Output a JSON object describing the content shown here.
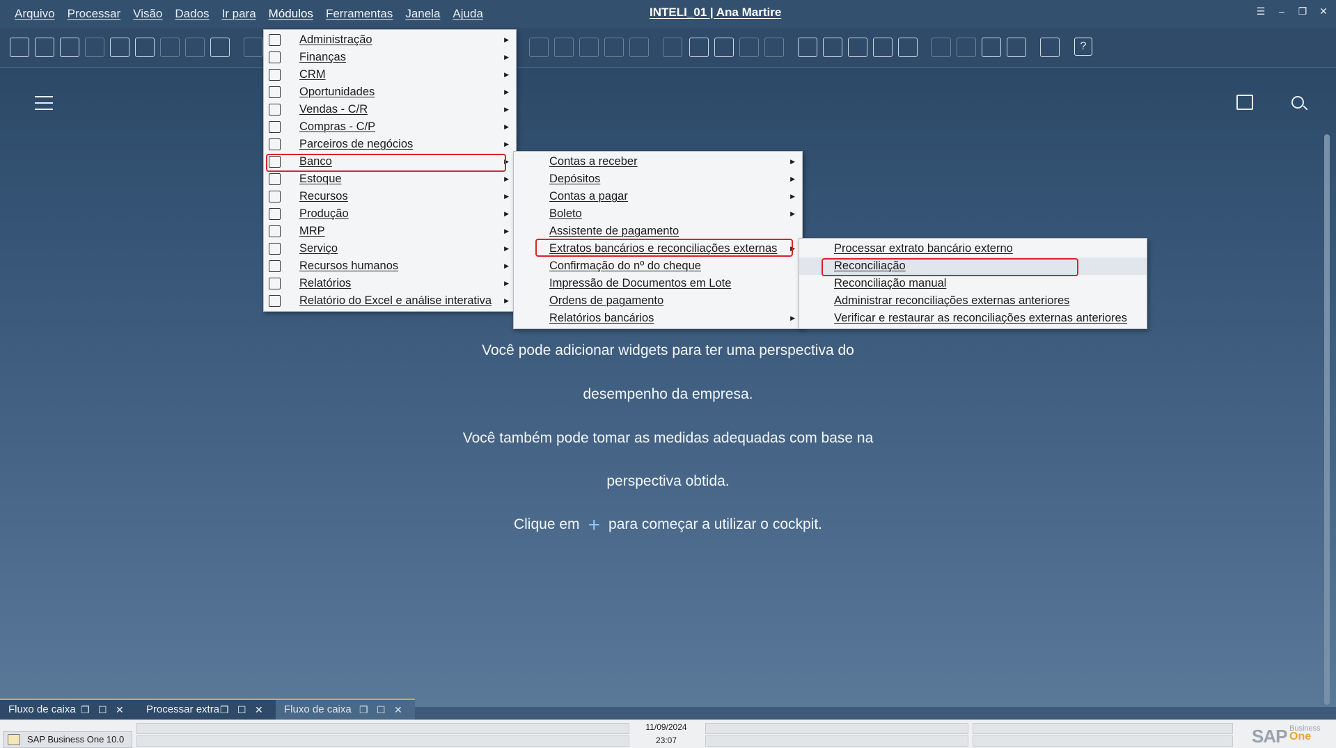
{
  "menubar": {
    "items": [
      "Arquivo",
      "Processar",
      "Visão",
      "Dados",
      "Ir para",
      "Módulos",
      "Ferramentas",
      "Janela",
      "Ajuda"
    ],
    "active": "Módulos",
    "window_title": "INTELI_01 | Ana Martire"
  },
  "main": {
    "info_line1": "Você pode adicionar widgets para ter uma perspectiva do",
    "info_line2": "desempenho da empresa.",
    "info_line3": "Você também pode tomar as medidas adequadas com base na",
    "info_line4": "perspectiva obtida.",
    "info_line5_pre": "Clique em",
    "info_line5_plus": "+",
    "info_line5_post": "para começar a utilizar o cockpit."
  },
  "modulos_menu": {
    "items": [
      {
        "label": "Administração",
        "icon": "admin-icon"
      },
      {
        "label": "Finanças",
        "icon": "finance-icon"
      },
      {
        "label": "CRM",
        "icon": "crm-icon"
      },
      {
        "label": "Oportunidades",
        "icon": "opportunities-icon"
      },
      {
        "label": "Vendas - C/R",
        "icon": "sales-icon"
      },
      {
        "label": "Compras - C/P",
        "icon": "cart-icon"
      },
      {
        "label": "Parceiros de negócios",
        "icon": "partners-icon"
      },
      {
        "label": "Banco",
        "icon": "bank-bag-icon"
      },
      {
        "label": "Estoque",
        "icon": "inventory-icon"
      },
      {
        "label": "Recursos",
        "icon": "resources-icon"
      },
      {
        "label": "Produção",
        "icon": "production-icon"
      },
      {
        "label": "MRP",
        "icon": "mrp-icon"
      },
      {
        "label": "Serviço",
        "icon": "service-icon"
      },
      {
        "label": "Recursos humanos",
        "icon": "hr-icon"
      },
      {
        "label": "Relatórios",
        "icon": "reports-icon"
      },
      {
        "label": "Relatório do Excel e análise interativa",
        "icon": "excel-report-icon"
      }
    ],
    "selected": "Banco"
  },
  "banco_menu": {
    "items": [
      {
        "label": "Contas a receber",
        "submenu": true
      },
      {
        "label": "Depósitos",
        "submenu": true
      },
      {
        "label": "Contas a pagar",
        "submenu": true
      },
      {
        "label": "Boleto",
        "submenu": true
      },
      {
        "label": "Assistente de pagamento",
        "submenu": false
      },
      {
        "label": "Extratos bancários e reconciliações externas",
        "submenu": true
      },
      {
        "label": "Confirmação do nº do cheque",
        "submenu": false
      },
      {
        "label": "Impressão de Documentos em Lote",
        "submenu": false
      },
      {
        "label": "Ordens de pagamento",
        "submenu": false
      },
      {
        "label": "Relatórios bancários",
        "submenu": true
      }
    ],
    "selected": "Extratos bancários e reconciliações externas"
  },
  "extratos_menu": {
    "items": [
      {
        "label": "Processar extrato bancário externo"
      },
      {
        "label": "Reconciliação"
      },
      {
        "label": "Reconciliação manual"
      },
      {
        "label": "Administrar reconciliações externas anteriores"
      },
      {
        "label": "Verificar e restaurar as reconciliações externas anteriores"
      }
    ],
    "selected": "Reconciliação"
  },
  "tabs": [
    {
      "label": "Fluxo de caixa"
    },
    {
      "label": "Processar extra"
    },
    {
      "label": "Fluxo de caixa"
    }
  ],
  "statusbar": {
    "app_label": "SAP Business One 10.0",
    "date": "11/09/2024",
    "time": "23:07",
    "logo_text": "SAP",
    "logo_sub1": "Business",
    "logo_sub2": "One"
  },
  "colors": {
    "highlight_border": "#d9232e",
    "tab_accent": "#e8a33a",
    "menubar_bg": "#33506e"
  }
}
